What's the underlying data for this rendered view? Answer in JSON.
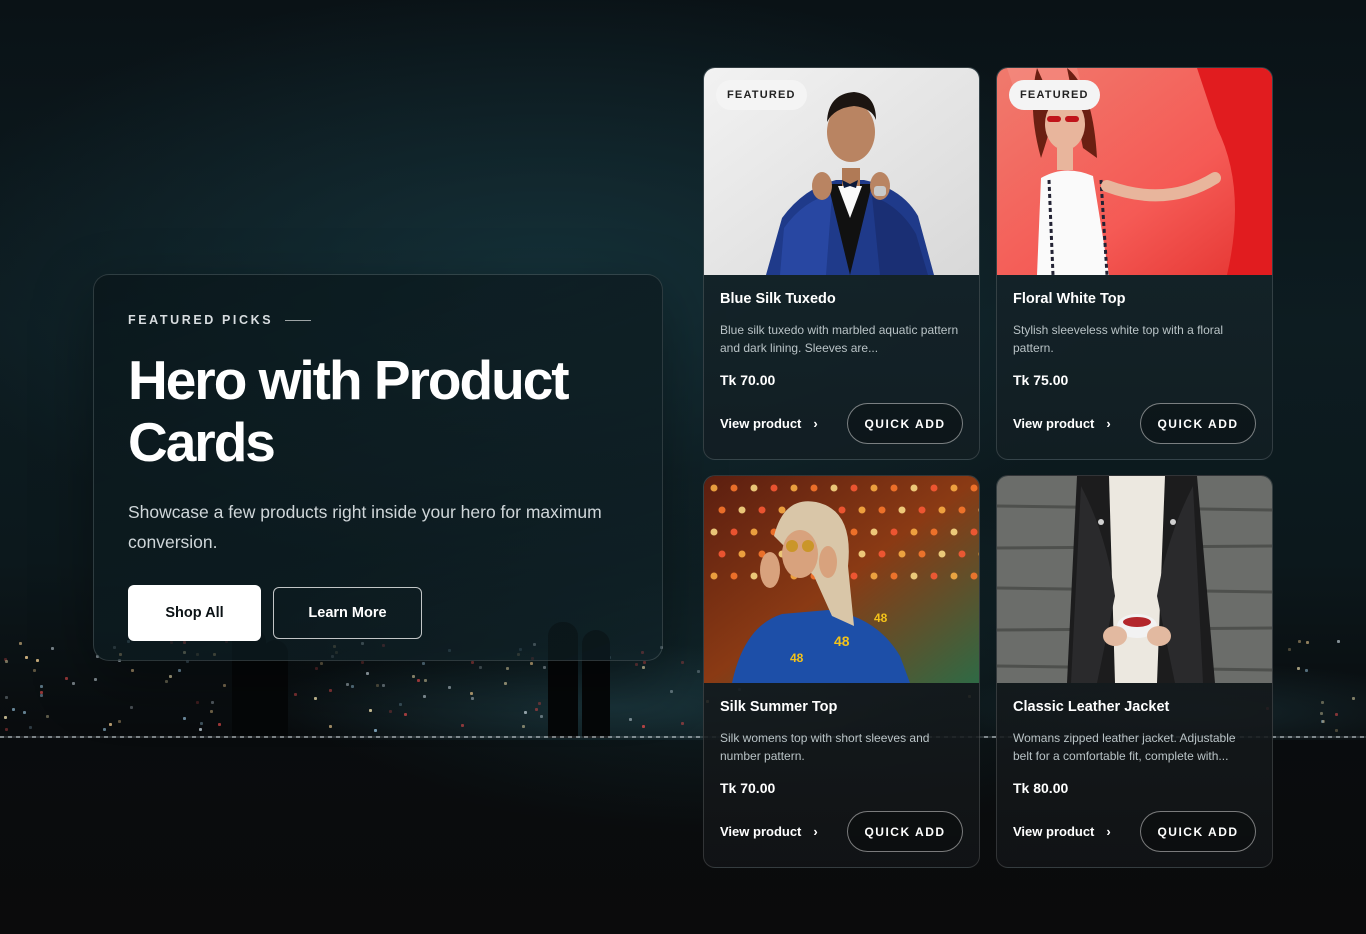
{
  "hero": {
    "eyebrow": "FEATURED PICKS",
    "title": "Hero with Product Cards",
    "subtitle": "Showcase a few products right inside your hero for maximum conversion.",
    "primary_label": "Shop All",
    "secondary_label": "Learn More"
  },
  "products": [
    {
      "badge": "FEATURED",
      "name": "Blue Silk Tuxedo",
      "description": "Blue silk tuxedo with marbled aquatic pattern and dark lining. Sleeves are...",
      "price": "Tk 70.00",
      "view_label": "View product",
      "quick_add_label": "QUICK ADD"
    },
    {
      "badge": "FEATURED",
      "name": "Floral White Top",
      "description": "Stylish sleeveless white top with a floral pattern.",
      "price": "Tk 75.00",
      "view_label": "View product",
      "quick_add_label": "QUICK ADD"
    },
    {
      "name": "Silk Summer Top",
      "description": "Silk womens top with short sleeves and number pattern.",
      "price": "Tk 70.00",
      "view_label": "View product",
      "quick_add_label": "QUICK ADD"
    },
    {
      "name": "Classic Leather Jacket",
      "description": "Womans zipped leather jacket. Adjustable belt for a comfortable fit, complete with...",
      "price": "Tk 80.00",
      "view_label": "View product",
      "quick_add_label": "QUICK ADD"
    }
  ],
  "icons": {
    "chevron": "chevron-right-icon"
  },
  "colors": {
    "background": "#0c181c",
    "card": "#16282e",
    "primary_button": "#ffffff",
    "badge": "#f4f4f4"
  }
}
